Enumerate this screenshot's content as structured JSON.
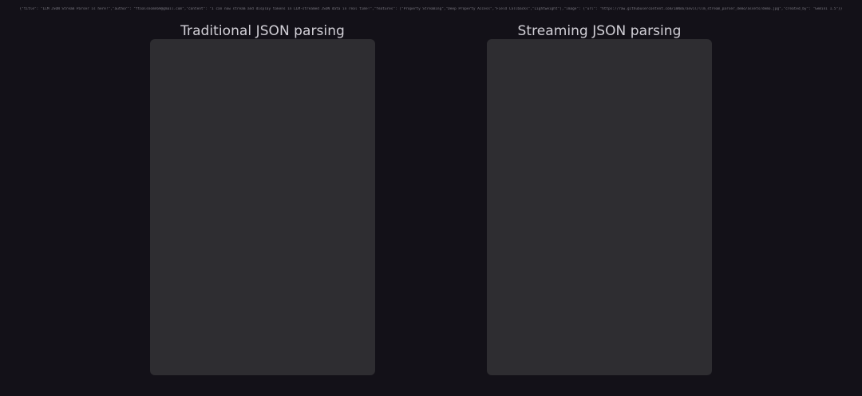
{
  "header": {
    "raw_json": "{\"title\": \"LLM JSON Stream Parser is here!\",\"author\": \"ftoalsnomn69@gmail.com\",\"content\": \"I can now stream and display tokens in LLM-streamed JSON data in real time!\",\"features\": [\"Property Streaming\",\"Deep Property Access\",\"Field Callbacks\",\"Lightweight\"],\"image\": {\"url\": \"https://raw.githubusercontent.com/ImNo6/anvil/llm_stream_parser_demo/assets/demo.jpg\",\"created_by\": \"Gemini 1.5\"}}"
  },
  "panels": [
    {
      "title": "Traditional JSON parsing"
    },
    {
      "title": "Streaming JSON parsing"
    }
  ],
  "colors": {
    "background": "#131118",
    "panel": "#2e2d31",
    "title_text": "#d2d0d7",
    "raw_json_text": "#7b7982"
  }
}
